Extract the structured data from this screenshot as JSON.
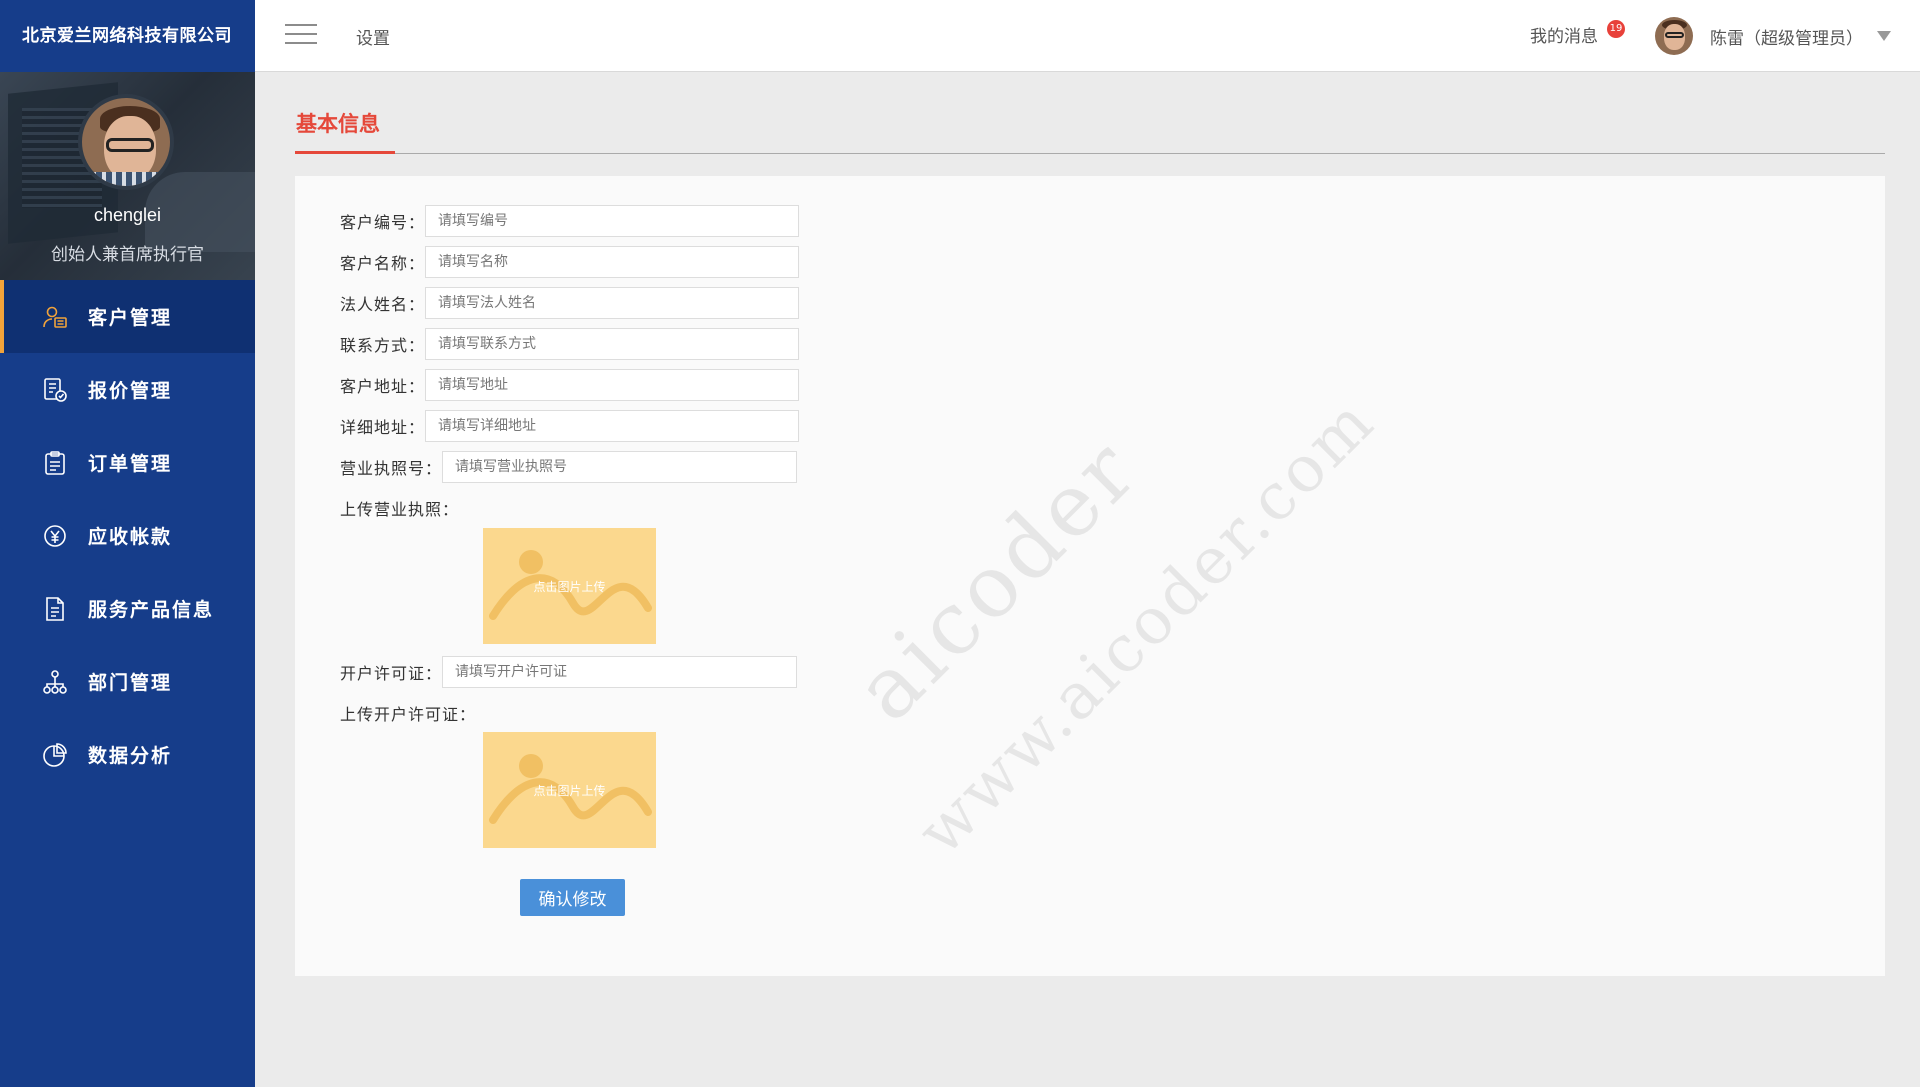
{
  "sidebar": {
    "company": "北京爱兰网络科技有限公司",
    "profile": {
      "username": "chenglei",
      "title": "创始人兼首席执行官"
    },
    "items": [
      {
        "label": "客户管理",
        "icon": "customer-icon",
        "active": true
      },
      {
        "label": "报价管理",
        "icon": "quote-icon"
      },
      {
        "label": "订单管理",
        "icon": "order-icon"
      },
      {
        "label": "应收帐款",
        "icon": "receivable-icon"
      },
      {
        "label": "服务产品信息",
        "icon": "product-icon"
      },
      {
        "label": "部门管理",
        "icon": "department-icon"
      },
      {
        "label": "数据分析",
        "icon": "analytics-icon"
      }
    ]
  },
  "header": {
    "breadcrumb": "设置",
    "messages_label": "我的消息",
    "messages_count": "19",
    "user_label": "陈雷（超级管理员）"
  },
  "main": {
    "section_title": "基本信息",
    "fields": [
      {
        "label": "客户编号：",
        "placeholder": "请填写编号",
        "value": ""
      },
      {
        "label": "客户名称：",
        "placeholder": "请填写名称",
        "value": ""
      },
      {
        "label": "法人姓名：",
        "placeholder": "请填写法人姓名",
        "value": ""
      },
      {
        "label": "联系方式：",
        "placeholder": "请填写联系方式",
        "value": ""
      },
      {
        "label": "客户地址：",
        "placeholder": "请填写地址",
        "value": ""
      },
      {
        "label": "详细地址：",
        "placeholder": "请填写详细地址",
        "value": ""
      },
      {
        "label": "营业执照号：",
        "placeholder": "请填写营业执照号",
        "value": ""
      }
    ],
    "upload_license_label": "上传营业执照：",
    "upload_text": "点击图片上传",
    "account_permit": {
      "label": "开户许可证：",
      "placeholder": "请填写开户许可证",
      "value": ""
    },
    "upload_permit_label": "上传开户许可证：",
    "confirm_label": "确认修改",
    "watermark_1": "aicoder",
    "watermark_2": "www.aicoder.com"
  },
  "colors": {
    "sidebar_bg": "#163d8a",
    "sidebar_active_bg": "#0f3072",
    "active_marker": "#f1a33b",
    "accent_red": "#e5483a",
    "button_blue": "#4a90d9",
    "upload_bg": "#fbd88e"
  }
}
